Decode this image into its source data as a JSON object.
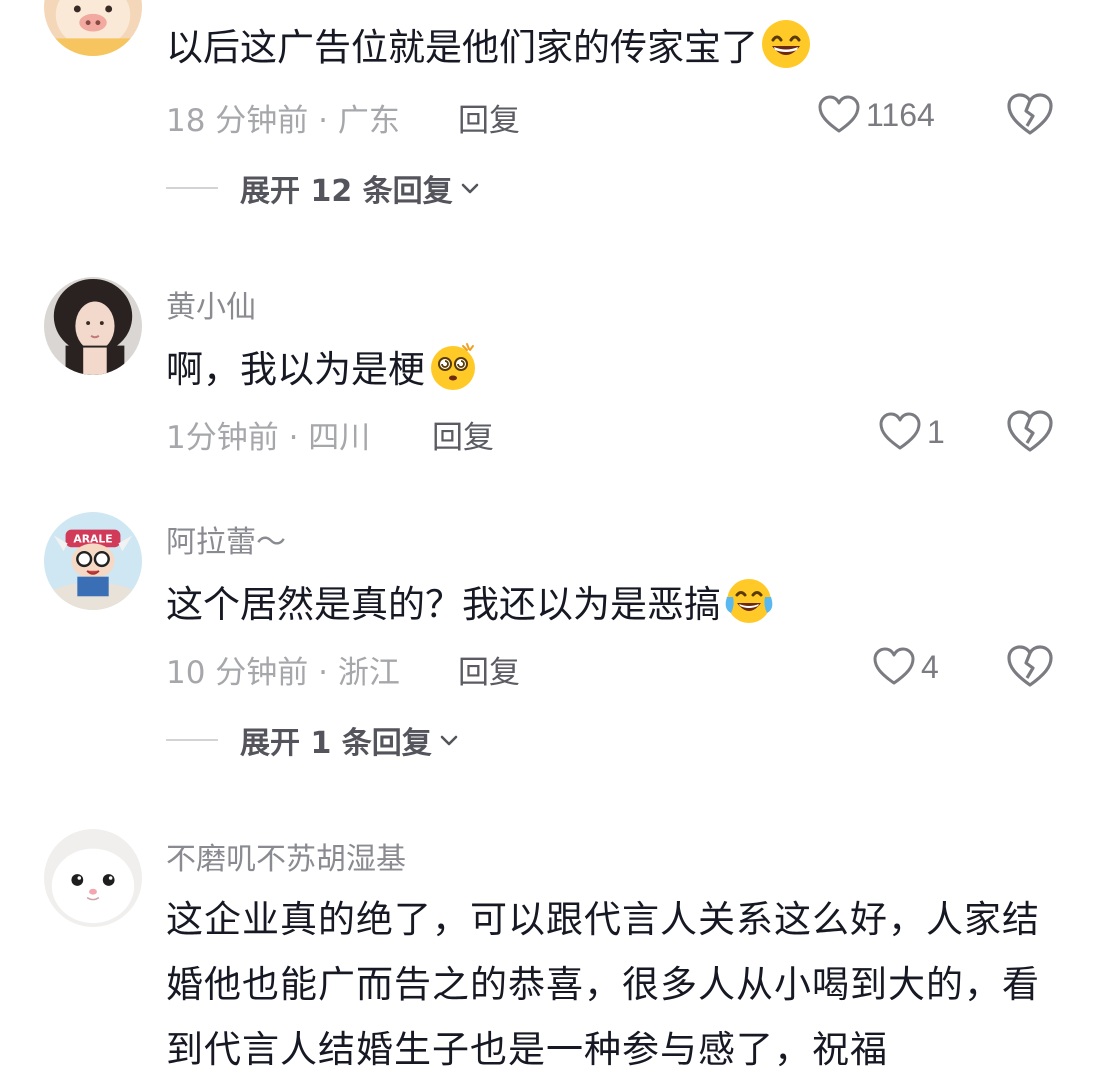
{
  "comments": [
    {
      "username": "",
      "text": "以后这广告位就是他们家的传家宝了",
      "emoji": "grinning-face-emoji",
      "time": "18 分钟前",
      "location": "广东",
      "reply_label": "回复",
      "likes": "1164",
      "expand_label": "展开 12 条回复"
    },
    {
      "username": "黄小仙",
      "text": "啊，我以为是梗",
      "emoji": "dizzy-face-emoji",
      "time": "1分钟前",
      "location": "四川",
      "reply_label": "回复",
      "likes": "1"
    },
    {
      "username": "阿拉蕾～",
      "text": "这个居然是真的？我还以为是恶搞",
      "emoji": "laughing-tears-emoji",
      "time": "10 分钟前",
      "location": "浙江",
      "reply_label": "回复",
      "likes": "4",
      "expand_label": "展开 1 条回复"
    },
    {
      "username": "不磨叽不苏胡湿基",
      "text": "这企业真的绝了，可以跟代言人关系这么好，人家结婚他也能广而告之的恭喜，很多人从小喝到大的，看到代言人结婚生子也是一种参与感了，祝福"
    }
  ],
  "meta_separator": " · ",
  "colors": {
    "text_primary": "#161823",
    "text_secondary": "#8a8b91",
    "meta": "#a6a7ab",
    "emoji_yellow": "#ffc928"
  },
  "icons": {
    "like": "heart-outline-icon",
    "dislike": "broken-heart-icon",
    "expand": "chevron-down-icon"
  }
}
